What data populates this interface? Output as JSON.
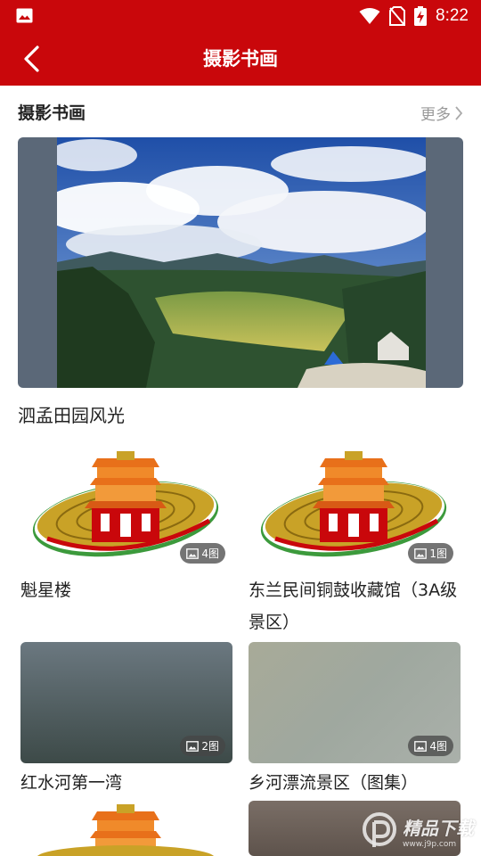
{
  "status_bar": {
    "time": "8:22",
    "icons": [
      "image-icon",
      "wifi-icon",
      "no-sim-icon",
      "battery-charging-icon"
    ]
  },
  "app_bar": {
    "title": "摄影书画",
    "back_icon": "chevron-left-icon"
  },
  "section": {
    "title": "摄影书画",
    "more_label": "更多"
  },
  "featured": {
    "caption": "泗孟田园风光"
  },
  "cards": [
    {
      "caption": "魁星楼",
      "count": "4图"
    },
    {
      "caption": "东兰民间铜鼓收藏馆（3A级景区）",
      "count": "1图"
    },
    {
      "caption": "红水河第一湾",
      "count": "2图"
    },
    {
      "caption": "乡河漂流景区（图集）",
      "count": "4图"
    }
  ],
  "watermark": {
    "text": "精品下载",
    "sub": "www.j9p.com"
  },
  "colors": {
    "brand_red": "#c9070b",
    "muted": "#999999"
  }
}
